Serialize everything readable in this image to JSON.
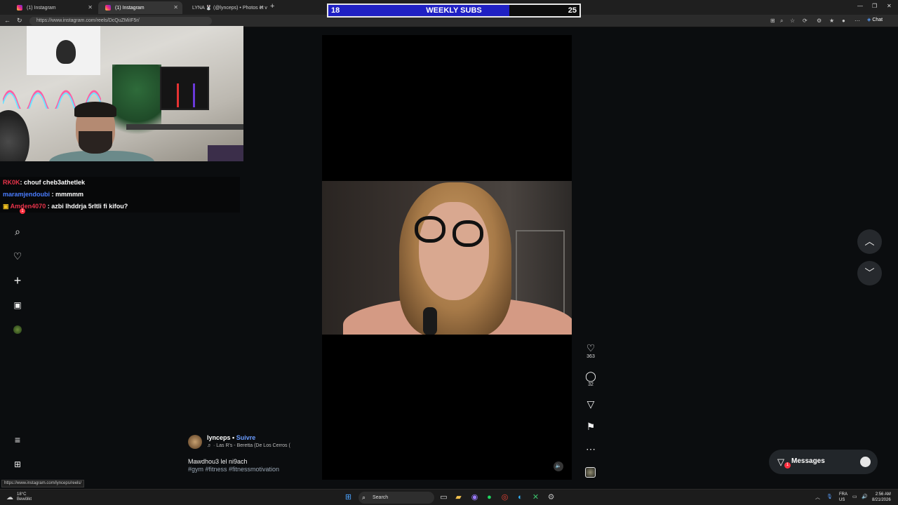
{
  "browser": {
    "tabs": [
      {
        "label": "(1) Instagram",
        "active": false
      },
      {
        "label": "(1) Instagram",
        "active": true
      },
      {
        "label": "LYNA 🐰 (@lynceps) • Photos et v",
        "active": false
      }
    ],
    "url": "https://www.instagram.com/reels/DcQuZMiIF5r/",
    "chat_label": "Chat",
    "status_url": "https://www.instagram.com/lynceps/reels/"
  },
  "overlay": {
    "subs_current": "18",
    "subs_title": "WEEKLY SUBS",
    "subs_goal": "25",
    "subs_progress": 0.72,
    "fill_color": "#1f20c4"
  },
  "chat": [
    {
      "user": "RK0K",
      "text": ": chouf cheb3athetlek",
      "color": "#e8334a"
    },
    {
      "user": "maramjendoubi",
      "text": " : mmmmm",
      "color": "#4a7dff"
    },
    {
      "user": "Amden4070",
      "text": " : azbi lhddrja 5rItli fi kifou?",
      "color": "#e8334a"
    }
  ],
  "sidebar": {
    "notification_count": "1"
  },
  "reel": {
    "author": "lynceps",
    "separator": " • ",
    "follow": "Suivre",
    "audio": "· Las R's - Beretta (De Los Cerros (",
    "caption": "Mawdhou3 lel ni9ach",
    "hashtags": "#gym #fitness #fitnessmotivation",
    "likes": "363",
    "comments": "32"
  },
  "messages": {
    "label": "Messages",
    "badge": "1"
  },
  "taskbar": {
    "temp": "18°C",
    "weather_text": "Bewölkt",
    "search": "Search",
    "lang_line1": "FRA",
    "lang_line2": "US",
    "time": "2:56 AM",
    "date": "8/21/2026"
  },
  "colors": {
    "accent": "#6b9cff",
    "badge": "#ff3040",
    "background": "#0b0d0f"
  }
}
